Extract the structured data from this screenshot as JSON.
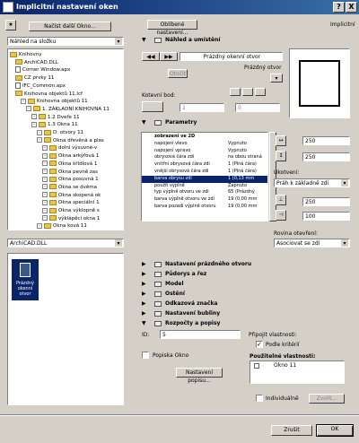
{
  "window": {
    "title": "Implicitní nastavení oken",
    "help_label": "?",
    "close_label": "X"
  },
  "top": {
    "favorites_btn": "Oblíbené nastavení...",
    "load_btn": "Načíst další Okno...",
    "implicit_label": "Implicitní"
  },
  "left": {
    "filter_select": "Náhled na složku",
    "tree": [
      {
        "label": "Knihovny",
        "level": 0,
        "icon": "folder",
        "sel": false
      },
      {
        "label": "ArchiCAD.DLL",
        "level": 1,
        "icon": "folder",
        "sel": false
      },
      {
        "label": "Corner Window.apx",
        "level": 1,
        "icon": "doc",
        "sel": false
      },
      {
        "label": "CZ prvky 11",
        "level": 1,
        "icon": "folder",
        "sel": false
      },
      {
        "label": "IFC_Common.apx",
        "level": 1,
        "icon": "doc",
        "sel": false
      },
      {
        "label": "Knihovna objektů 11.lcf",
        "level": 1,
        "icon": "folder",
        "sel": false
      },
      {
        "label": "Knihovna objektů 11",
        "level": 2,
        "icon": "folder",
        "sel": false
      },
      {
        "label": "1. ZÁKLADNÍ KNIHOVNA 11",
        "level": 3,
        "icon": "folder",
        "sel": false
      },
      {
        "label": "1.2 Dveře 11",
        "level": 4,
        "icon": "folder",
        "sel": false
      },
      {
        "label": "1.3 Okna 11",
        "level": 4,
        "icon": "folder",
        "sel": false
      },
      {
        "label": "D. otvory 11",
        "level": 5,
        "icon": "folder",
        "sel": false
      },
      {
        "label": "Okna dřevěná a plas",
        "level": 5,
        "icon": "folder",
        "sel": false
      },
      {
        "label": "dolní výsuvné-v",
        "level": 6,
        "icon": "folder",
        "sel": false
      },
      {
        "label": "Okna arkýřová 1",
        "level": 6,
        "icon": "folder",
        "sel": false
      },
      {
        "label": "Okna křídlová 1",
        "level": 6,
        "icon": "folder",
        "sel": false
      },
      {
        "label": "Okna pevně zas",
        "level": 6,
        "icon": "folder",
        "sel": false
      },
      {
        "label": "Okna posuvná 1",
        "level": 6,
        "icon": "folder",
        "sel": false
      },
      {
        "label": "Okna se dvěma",
        "level": 6,
        "icon": "folder",
        "sel": false
      },
      {
        "label": "Okna skopená ok",
        "level": 6,
        "icon": "folder",
        "sel": false
      },
      {
        "label": "Okna speciální 1",
        "level": 6,
        "icon": "folder",
        "sel": false
      },
      {
        "label": "Okna výklopně s",
        "level": 6,
        "icon": "folder",
        "sel": false
      },
      {
        "label": "výklápěcí okna 1",
        "level": 6,
        "icon": "folder",
        "sel": false
      },
      {
        "label": "Okna ková 11",
        "level": 5,
        "icon": "folder",
        "sel": false
      }
    ],
    "lib_select": "ArchiCAD.DLL",
    "preview_item": "Prázdný okenní otvor"
  },
  "preview": {
    "header": "Náhled a umístění",
    "name_field": "Prázdný okenní otvor",
    "open_btn": "Otočit",
    "type_label": "Prázdný otvor",
    "anchor_label": "Kotevní bod:",
    "anchor_value": "1",
    "angle_value": "0"
  },
  "params": {
    "header": "Parametry",
    "rows": [
      {
        "k": "zobrazení ve 2D",
        "v": ""
      },
      {
        "k": "napojení vlevo",
        "v": "Vypnuto"
      },
      {
        "k": "napojení vpravo",
        "v": "Vypnuto"
      },
      {
        "k": "obrysová čára zdi",
        "v": "na obou straná"
      },
      {
        "k": "vnitřní obrysová čára zdi",
        "v": "1 (Plná čára)"
      },
      {
        "k": "vnější obrysová čára zdi",
        "v": "1 (Plná čára)"
      },
      {
        "k": "barva obrysu zdi",
        "v": "1 (0,13 mm"
      },
      {
        "k": "použít výplně",
        "v": "Zapnuto"
      },
      {
        "k": "typ výplně otvoru ve zdi",
        "v": "65 (Prázdný"
      },
      {
        "k": "barva výplně otvoru ve zdi",
        "v": "19 (0,00 mm"
      },
      {
        "k": "barva pozadí výplně otvoru",
        "v": "19 (0,00 mm"
      }
    ],
    "width": "250",
    "height": "250",
    "anchor_label": "Ukotvení:",
    "anchor_select": "Práh k základně zdi",
    "sill_value": "250",
    "depth_value": "100",
    "plane_label": "Rovina otevření:",
    "plane_select": "Asociovat se zdí"
  },
  "sections": {
    "s1": "Nastavení prázdného otvoru",
    "s2": "Půdorys a řez",
    "s3": "Model",
    "s4": "Ostění",
    "s5": "Odkazová značka",
    "s6": "Nastavení bubliny",
    "s7": "Rozpočty a popisy"
  },
  "listing": {
    "id_label": "ID:",
    "id_value": "5",
    "label_checkbox": "Popiska Okno",
    "label_btn": "Nastavení popisu...",
    "prop_label": "Připojit vlastnosti:",
    "by_criteria": "Podle kritérií",
    "used_label": "Použitelné vlastnosti:",
    "used_item": "Okno 11",
    "individual": "Individuálně",
    "choose_btn": "Zvolit..."
  },
  "footer": {
    "cancel": "Zrušit",
    "ok": "OK"
  }
}
